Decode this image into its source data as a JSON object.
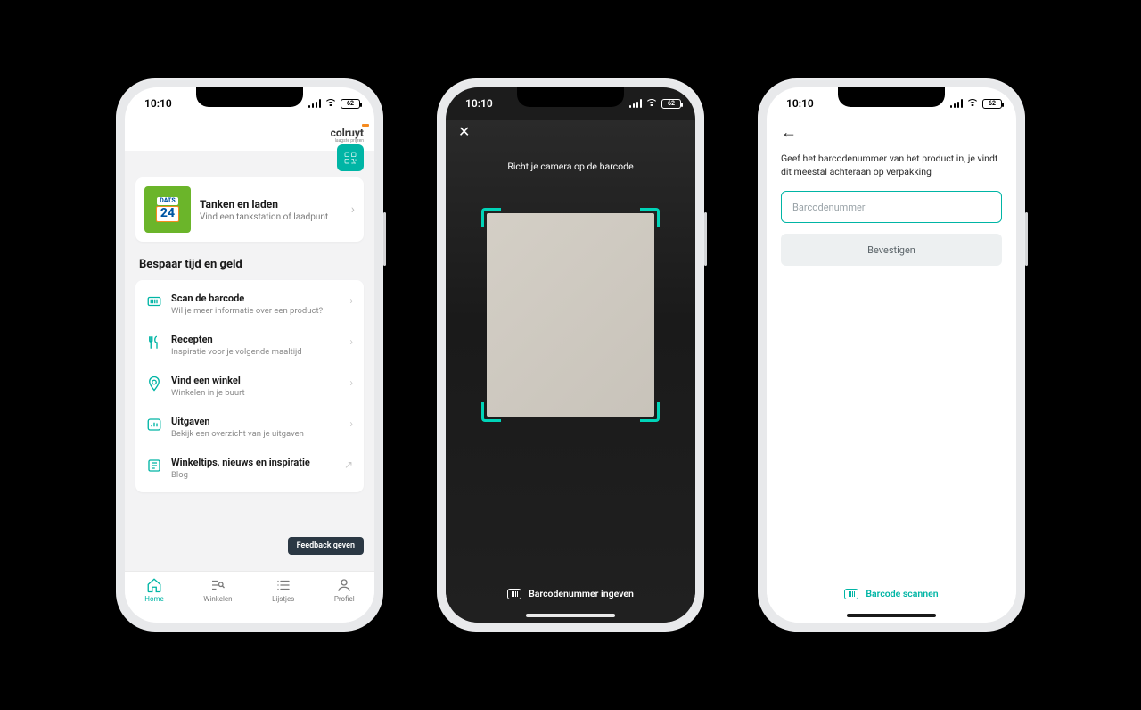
{
  "status": {
    "time": "10:10",
    "battery": "62"
  },
  "phone1": {
    "brand": "colruyt",
    "brand_sub": "laagste prijzen",
    "hero": {
      "title": "Tanken en laden",
      "subtitle": "Vind een tankstation of laadpunt"
    },
    "section_title": "Bespaar tijd en geld",
    "items": [
      {
        "title": "Scan de barcode",
        "subtitle": "Wil je meer informatie over een product?"
      },
      {
        "title": "Recepten",
        "subtitle": "Inspiratie voor je volgende maaltijd"
      },
      {
        "title": "Vind een winkel",
        "subtitle": "Winkelen in je buurt"
      },
      {
        "title": "Uitgaven",
        "subtitle": "Bekijk een overzicht van je uitgaven"
      },
      {
        "title": "Winkeltips, nieuws en inspiratie",
        "subtitle": "Blog"
      }
    ],
    "feedback": "Feedback geven",
    "tabs": [
      {
        "label": "Home"
      },
      {
        "label": "Winkelen"
      },
      {
        "label": "Lijstjes"
      },
      {
        "label": "Profiel"
      }
    ]
  },
  "phone2": {
    "instruction": "Richt je camera op de barcode",
    "bottom_action": "Barcodenummer ingeven"
  },
  "phone3": {
    "instruction": "Geef het barcodenummer van het product in, je vindt dit meestal achteraan op verpakking",
    "placeholder": "Barcodenummer",
    "confirm": "Bevestigen",
    "bottom_action": "Barcode scannen"
  }
}
